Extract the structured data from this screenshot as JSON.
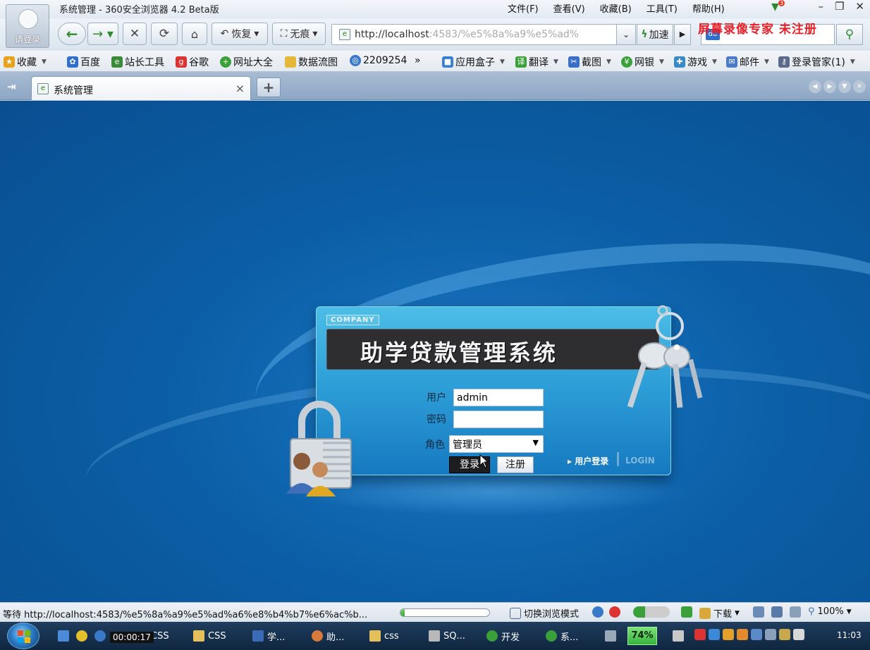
{
  "window": {
    "title": "系统管理 - 360安全浏览器 4.2 Beta版",
    "avatar_label": "请登录",
    "menu": [
      "文件(F)",
      "查看(V)",
      "收藏(B)",
      "工具(T)",
      "帮助(H)"
    ],
    "notification_count": "3",
    "controls": [
      "–",
      "❐",
      "✕"
    ]
  },
  "toolbar": {
    "restore_label": "恢复",
    "notrace_label": "无痕",
    "address_host": "http://localhost",
    "address_rest": ":4583/%e5%8a%a9%e5%ad%",
    "speed_label": "加速",
    "watermark": "屏幕录像专家 未注册"
  },
  "favorites": {
    "items": [
      {
        "label": "收藏",
        "color": "#e8a21c",
        "icon": "star-icon"
      },
      {
        "label": "百度",
        "color": "#2f6fd0",
        "icon": "baidu-icon"
      },
      {
        "label": "站长工具",
        "color": "#3a8a3a",
        "icon": "page-icon"
      },
      {
        "label": "谷歌",
        "color": "#d33",
        "icon": "google-icon"
      },
      {
        "label": "网址大全",
        "color": "#3aa03a",
        "icon": "globe-icon"
      },
      {
        "label": "数据流图",
        "color": "#e5b83a",
        "icon": "folder-icon"
      },
      {
        "label": "2209254",
        "color": "#3a78c8",
        "icon": "globe-icon"
      },
      {
        "label": "应用盒子",
        "color": "#3a7fd0",
        "icon": "box-icon"
      },
      {
        "label": "翻译",
        "color": "#3aa03a",
        "icon": "translate-icon"
      },
      {
        "label": "截图",
        "color": "#3a6fc8",
        "icon": "screenshot-icon"
      },
      {
        "label": "网银",
        "color": "#3aa03a",
        "icon": "bank-icon"
      },
      {
        "label": "游戏",
        "color": "#3a8ac8",
        "icon": "game-icon"
      },
      {
        "label": "邮件",
        "color": "#4a7ac8",
        "icon": "mail-icon"
      },
      {
        "label": "登录管家(1)",
        "color": "#5a6a8a",
        "icon": "key-icon"
      }
    ],
    "more": "»"
  },
  "tabs": {
    "active_title": "系统管理",
    "close": "×",
    "new": "+"
  },
  "login": {
    "company": "COMPANY",
    "system_title": "助学贷款管理系统",
    "user_label": "用户",
    "user_value": "admin",
    "password_label": "密码",
    "password_value": "",
    "role_label": "角色",
    "role_value": "管理员",
    "login_button": "登录",
    "register_button": "注册",
    "user_login_link": "▸ 用户登录",
    "login_en": "LOGIN"
  },
  "statusbar": {
    "status_text": "等待 http://localhost:4583/%e5%8a%a9%e5%ad%a6%e8%b4%b7%e6%ac%b...",
    "progress_fraction": 0.05,
    "switch_mode": "切换浏览模式",
    "download": "下载",
    "zoom": "100%"
  },
  "taskbar": {
    "timer": "00:00:17",
    "items": [
      "CSS",
      "CSS",
      "学...",
      "助...",
      "css",
      "SQ...",
      "开发",
      "系..."
    ],
    "battery": "74%",
    "clock": "11:03"
  }
}
